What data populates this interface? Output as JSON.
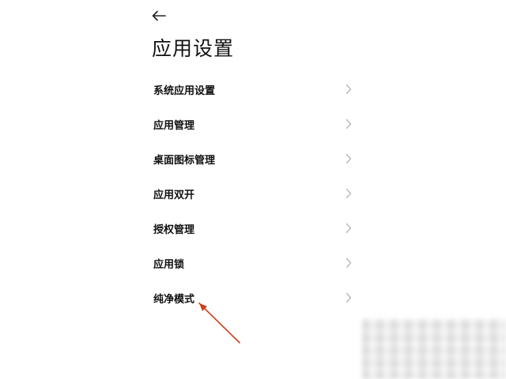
{
  "header": {
    "back_icon": "arrow-left-icon",
    "title": "应用设置"
  },
  "settings": {
    "items": [
      {
        "label": "系统应用设置",
        "icon": "chevron-right-icon"
      },
      {
        "label": "应用管理",
        "icon": "chevron-right-icon"
      },
      {
        "label": "桌面图标管理",
        "icon": "chevron-right-icon"
      },
      {
        "label": "应用双开",
        "icon": "chevron-right-icon"
      },
      {
        "label": "授权管理",
        "icon": "chevron-right-icon"
      },
      {
        "label": "应用锁",
        "icon": "chevron-right-icon"
      },
      {
        "label": "纯净模式",
        "icon": "chevron-right-icon"
      }
    ]
  },
  "colors": {
    "background": "#ffffff",
    "text": "#111111",
    "chevron": "#b8b8b8",
    "annotation_arrow": "#c8401c"
  }
}
